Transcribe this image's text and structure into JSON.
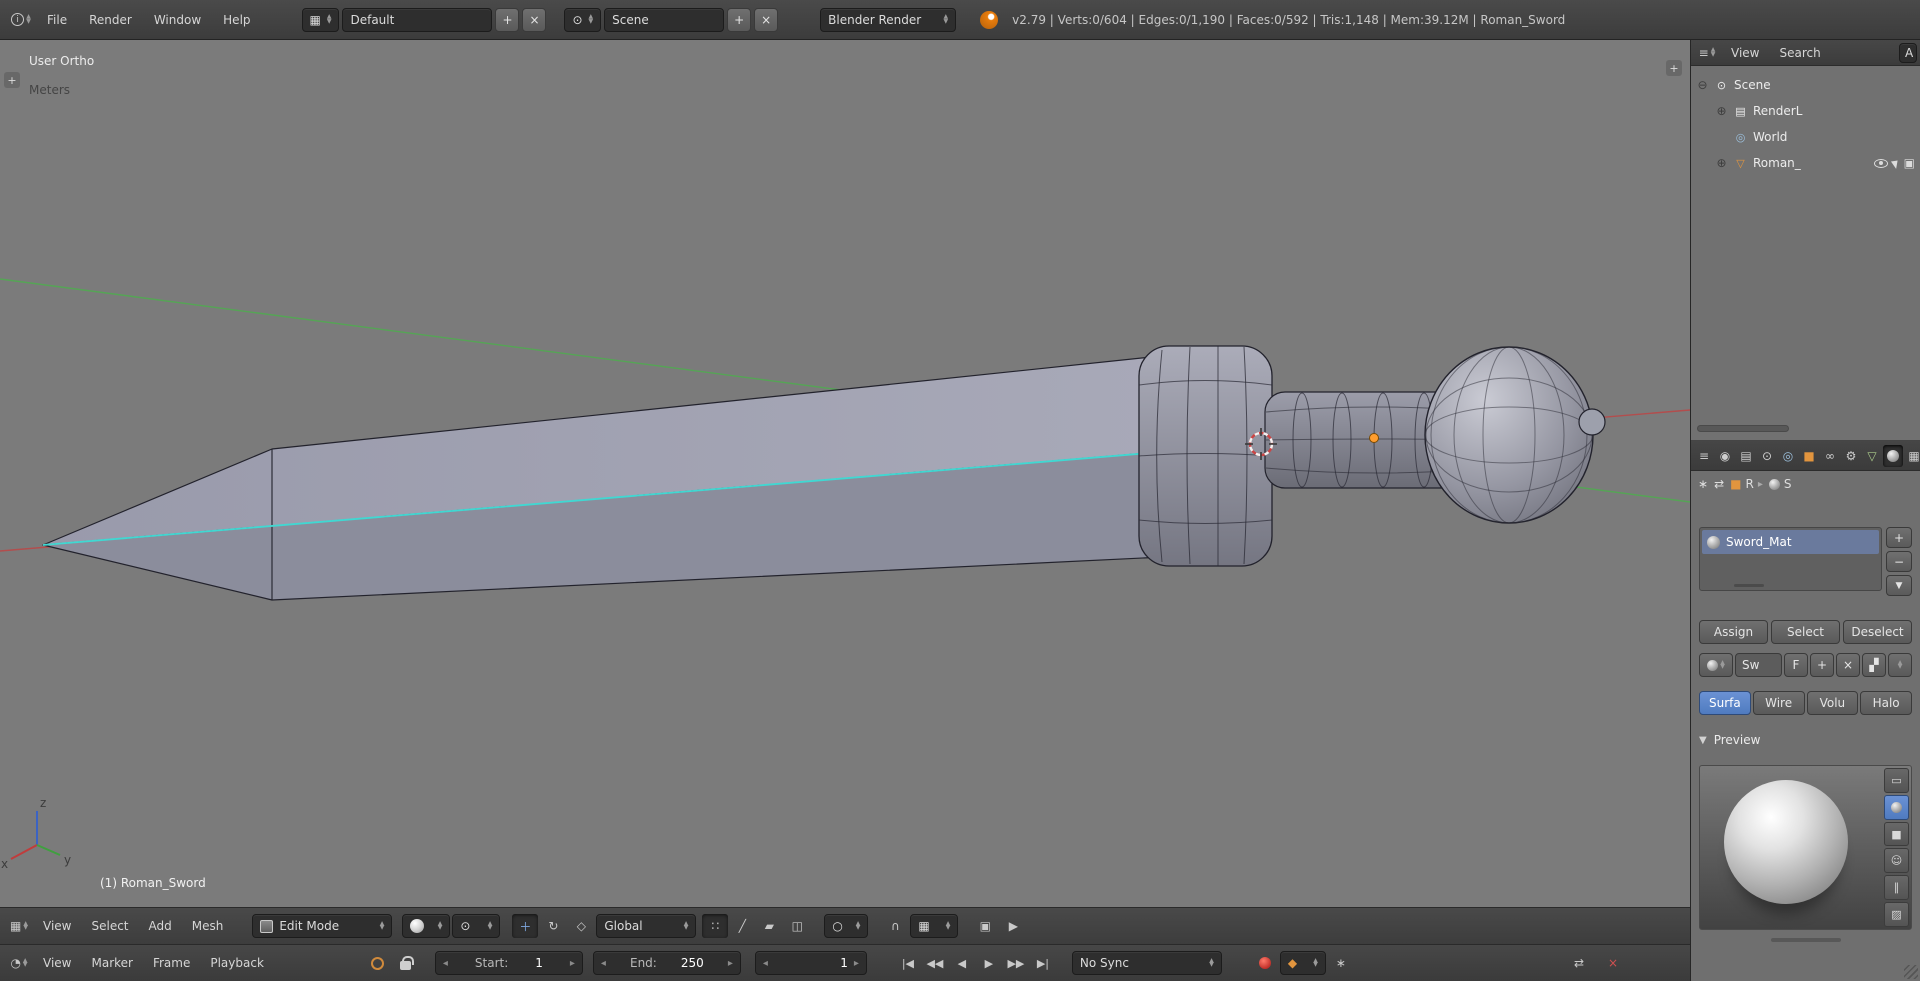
{
  "topbar": {
    "menus": [
      "File",
      "Render",
      "Window",
      "Help"
    ],
    "layout_value": "Default",
    "scene_value": "Scene",
    "engine_value": "Blender Render",
    "stats": "v2.79 | Verts:0/604 | Edges:0/1,190 | Faces:0/592 | Tris:1,148 | Mem:39.12M | Roman_Sword"
  },
  "viewport": {
    "view_label": "User Ortho",
    "unit_label": "Meters",
    "object_label": "(1) Roman_Sword",
    "axis_x": "x",
    "axis_y": "y",
    "axis_z": "z"
  },
  "view3d_header": {
    "menus": [
      "View",
      "Select",
      "Add",
      "Mesh"
    ],
    "mode_value": "Edit Mode",
    "orientation_value": "Global"
  },
  "timeline": {
    "menus": [
      "View",
      "Marker",
      "Frame",
      "Playback"
    ],
    "start_label": "Start:",
    "start_value": "1",
    "end_label": "End:",
    "end_value": "250",
    "frame_value": "1",
    "sync_value": "No Sync"
  },
  "outliner": {
    "menus": [
      "View",
      "Search"
    ],
    "clipped_menu": "A",
    "items": [
      {
        "label": "Scene"
      },
      {
        "label": "RenderL"
      },
      {
        "label": "World"
      },
      {
        "label": "Roman_"
      }
    ]
  },
  "properties": {
    "breadcrumb_object": "R",
    "breadcrumb_material": "S",
    "material_name": "Sword_Mat",
    "assign_label": "Assign",
    "select_label": "Select",
    "deselect_label": "Deselect",
    "datablock_name": "Sw",
    "fake_user_label": "F",
    "type_surface": "Surfa",
    "type_wire": "Wire",
    "type_volume": "Volu",
    "type_halo": "Halo",
    "preview_label": "Preview"
  },
  "icons": {
    "plus": "+",
    "minus": "−",
    "close": "×",
    "collapse_plus": "⊕",
    "collapse_minus": "⊖",
    "tri_down": "▼",
    "menu_arrow": "▸",
    "arrow_left": "◂",
    "arrow_right": "▸",
    "jump_start": "|◀",
    "prev_key": "◀◀",
    "play_rev": "◀",
    "play": "▶",
    "next_key": "▶▶",
    "jump_end": "▶|"
  },
  "colors": {
    "accent_blue": "#5680c2",
    "object_orange": "#ff9d2e",
    "axis_green": "#55a555",
    "axis_red": "#b34d4d",
    "select_cyan": "#40d8d2"
  }
}
